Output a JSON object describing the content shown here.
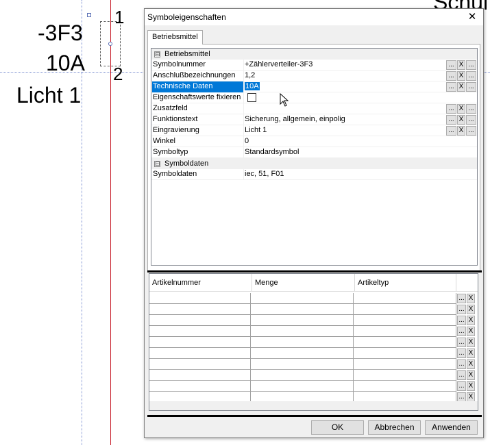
{
  "canvas": {
    "schematic_text": {
      "ref": "-3F3",
      "rating": "10A",
      "label": "Licht 1",
      "pin1": "1",
      "pin2": "2",
      "partial": "Schul"
    },
    "colors": {
      "guide_blue": "#7b8fd1",
      "guide_red": "#c8202c"
    }
  },
  "dialog": {
    "title": "Symboleigenschaften",
    "close_icon": "close-icon",
    "tab_label": "Betriebsmittel",
    "categories": [
      {
        "label": "Betriebsmittel",
        "toggle": "⊟",
        "properties": [
          {
            "name": "Symbolnummer",
            "value": "+Zählerverteiler-3F3",
            "buttons": true,
            "selected": false,
            "checkbox": false
          },
          {
            "name": "Anschlußbezeichnungen",
            "value": "1,2",
            "buttons": true,
            "selected": false,
            "checkbox": false
          },
          {
            "name": "Technische Daten",
            "value": "10A",
            "buttons": true,
            "selected": true,
            "checkbox": false
          },
          {
            "name": "Eigenschaftswerte fixieren",
            "value": "",
            "buttons": false,
            "selected": false,
            "checkbox": true,
            "checked": false
          },
          {
            "name": "Zusatzfeld",
            "value": "",
            "buttons": true,
            "selected": false,
            "checkbox": false
          },
          {
            "name": "Funktionstext",
            "value": "Sicherung, allgemein, einpolig",
            "buttons": true,
            "selected": false,
            "checkbox": false
          },
          {
            "name": "Eingravierung",
            "value": "Licht 1",
            "buttons": true,
            "selected": false,
            "checkbox": false
          },
          {
            "name": "Winkel",
            "value": "0",
            "buttons": false,
            "selected": false,
            "checkbox": false
          },
          {
            "name": "Symboltyp",
            "value": "Standardsymbol",
            "buttons": false,
            "selected": false,
            "checkbox": false
          }
        ]
      },
      {
        "label": "Symboldaten",
        "toggle": "⊟",
        "properties": [
          {
            "name": "Symboldaten",
            "value": "iec, 51, F01",
            "buttons": false,
            "selected": false,
            "checkbox": false
          }
        ]
      }
    ],
    "mini_button_labels": {
      "dots": "...",
      "x": "X"
    },
    "article_table": {
      "columns": [
        "Artikelnummer",
        "Menge",
        "Artikeltyp"
      ],
      "row_count": 10
    },
    "buttons": {
      "ok": "OK",
      "cancel": "Abbrechen",
      "apply": "Anwenden"
    }
  },
  "colors": {
    "selection": "#0078d7",
    "dialog_bg": "#f0f0f0",
    "button_bg": "#e1e1e1"
  }
}
